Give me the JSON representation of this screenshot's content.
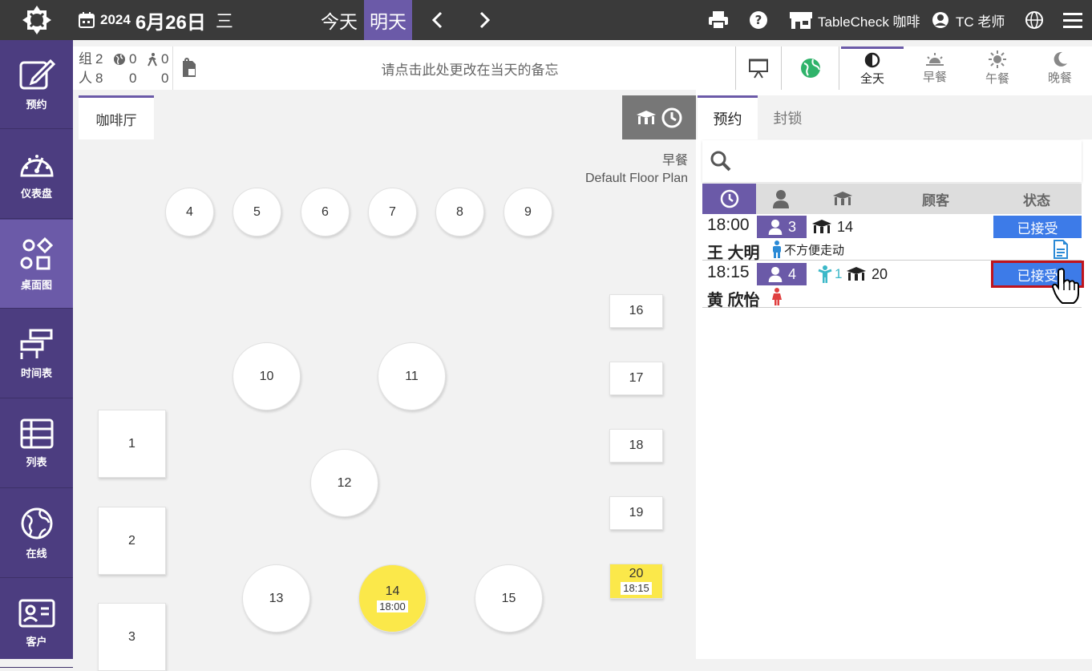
{
  "topbar": {
    "year": "2024",
    "month_day": "6月26日",
    "weekday": "三",
    "today_label": "今天",
    "tomorrow_label": "明天",
    "venue_name": "TableCheck 咖啡",
    "user_name": "TC 老师"
  },
  "sidebar": {
    "items": [
      {
        "label": "预约",
        "icon": "edit-icon"
      },
      {
        "label": "仪表盘",
        "icon": "dashboard-icon"
      },
      {
        "label": "桌面图",
        "icon": "floor-plan-icon"
      },
      {
        "label": "时间表",
        "icon": "timeline-icon"
      },
      {
        "label": "列表",
        "icon": "list-icon"
      },
      {
        "label": "在线",
        "icon": "globe-icon"
      },
      {
        "label": "客户",
        "icon": "customer-card-icon"
      }
    ]
  },
  "stats": {
    "groups_label": "组",
    "people_label": "人",
    "groups": "2",
    "groups_online": "0",
    "groups_walkin": "0",
    "people": "8",
    "people_online": "0",
    "people_walkin": "0"
  },
  "memo": {
    "placeholder": "请点击此处更改在当天的备忘"
  },
  "meals": [
    {
      "label": "全天",
      "icon": "half-circle-icon",
      "active": true
    },
    {
      "label": "早餐",
      "icon": "sunrise-icon",
      "active": false
    },
    {
      "label": "午餐",
      "icon": "sun-icon",
      "active": false
    },
    {
      "label": "晚餐",
      "icon": "moon-icon",
      "active": false
    }
  ],
  "floor": {
    "room_tab": "咖啡厅",
    "meal_label": "早餐",
    "plan_name": "Default Floor Plan",
    "tables": [
      {
        "label": "4"
      },
      {
        "label": "5"
      },
      {
        "label": "6"
      },
      {
        "label": "7"
      },
      {
        "label": "8"
      },
      {
        "label": "9"
      },
      {
        "label": "10"
      },
      {
        "label": "11"
      },
      {
        "label": "12"
      },
      {
        "label": "13"
      },
      {
        "label": "14",
        "time": "18:00"
      },
      {
        "label": "15"
      },
      {
        "label": "1"
      },
      {
        "label": "2"
      },
      {
        "label": "3"
      },
      {
        "label": "16"
      },
      {
        "label": "17"
      },
      {
        "label": "18"
      },
      {
        "label": "19"
      },
      {
        "label": "20",
        "time": "18:15"
      }
    ]
  },
  "panel": {
    "tabs": [
      "预约",
      "封锁"
    ],
    "columns": {
      "customer": "顾客",
      "status": "状态"
    },
    "reservations": [
      {
        "time": "18:00",
        "party": "3",
        "kids": "",
        "table": "14",
        "name": "王 大明",
        "tag": "不方便走动",
        "status": "已接受"
      },
      {
        "time": "18:15",
        "party": "4",
        "kids": "1",
        "table": "20",
        "name": "黄 欣怡",
        "tag": "",
        "status": "已接受"
      }
    ]
  },
  "colors": {
    "brand": "#6b5aa8",
    "status": "#3d7be8",
    "booked": "#fbe84a",
    "focus": "#c0141c"
  }
}
